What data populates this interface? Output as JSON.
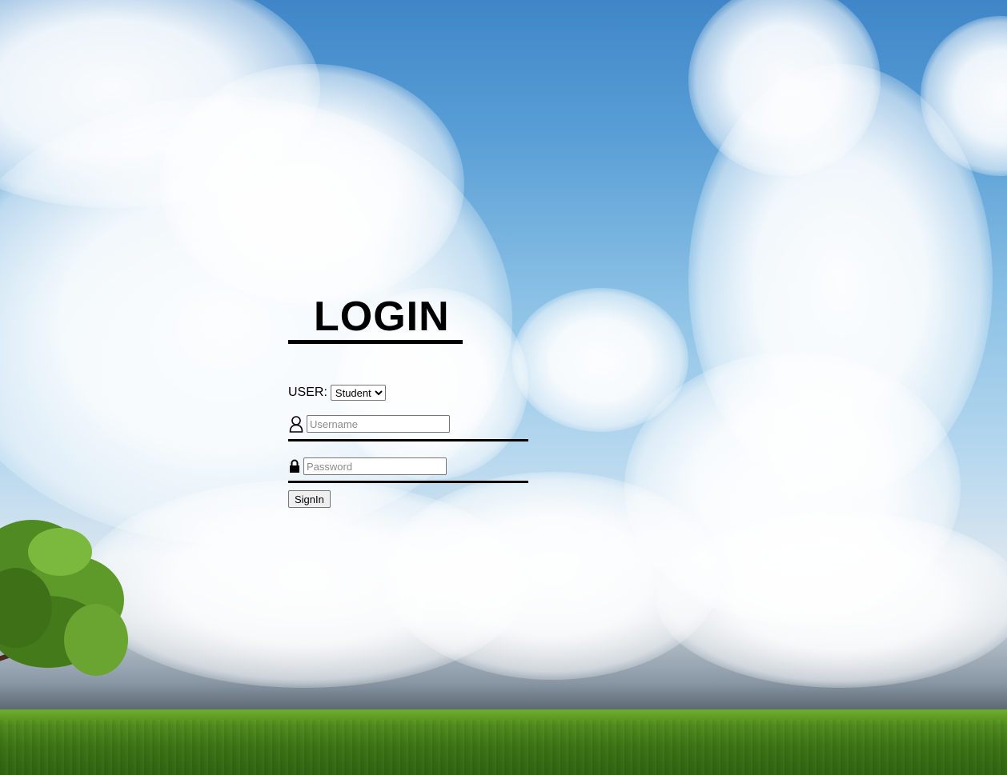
{
  "login": {
    "title": "LOGIN",
    "user_label": "USER:",
    "user_type_options": [
      "Student"
    ],
    "user_type_selected": "Student",
    "username_placeholder": "Username",
    "username_icon": "user-icon",
    "password_placeholder": "Password",
    "password_icon": "lock-icon",
    "signin_label": "SignIn"
  },
  "colors": {
    "text": "#000000",
    "sky_top": "#3f86c8",
    "grass": "#3c7415"
  }
}
